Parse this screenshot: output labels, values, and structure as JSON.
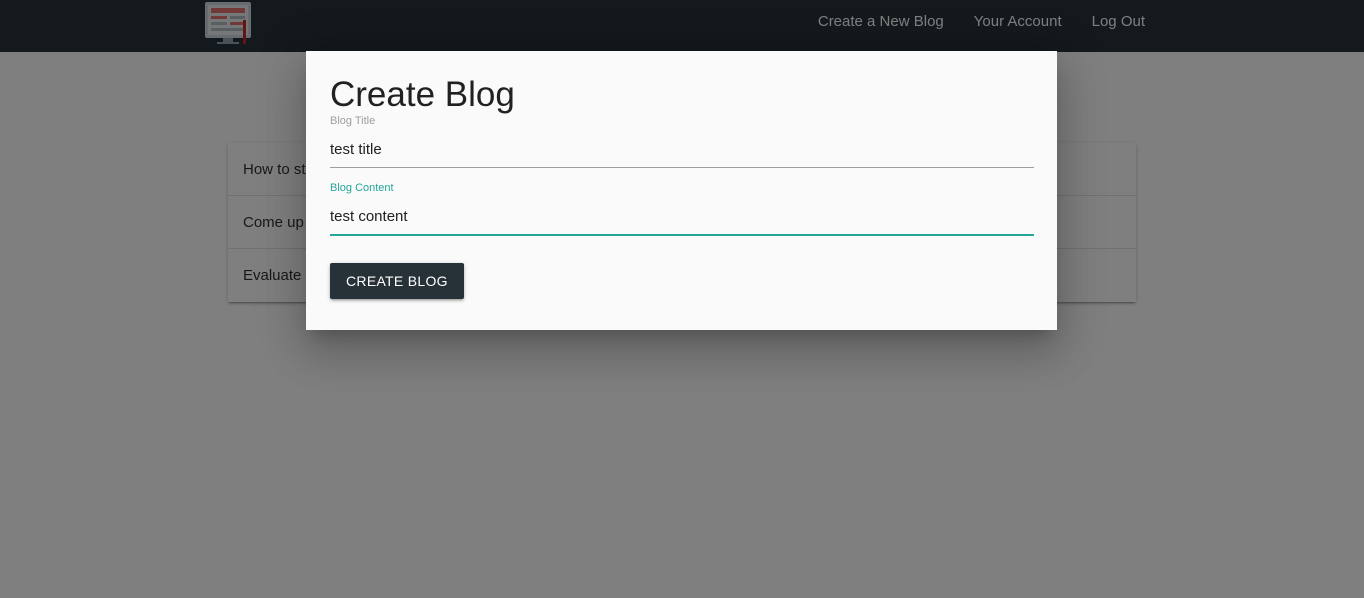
{
  "navbar": {
    "logo_icon": "blog-computer-logo",
    "links": [
      {
        "label": "Create a New Blog"
      },
      {
        "label": "Your Account"
      },
      {
        "label": "Log Out"
      }
    ]
  },
  "blog_list": {
    "items": [
      {
        "title": "How to st"
      },
      {
        "title": "Come up"
      },
      {
        "title": "Evaluate a"
      }
    ]
  },
  "modal": {
    "title": "Create Blog",
    "title_field": {
      "label": "Blog Title",
      "value": "test title"
    },
    "content_field": {
      "label": "Blog Content",
      "value": "test content"
    },
    "submit_label": "CREATE BLOG"
  },
  "colors": {
    "navbar": "#263238",
    "accent": "#26a69a",
    "button": "#263238"
  }
}
